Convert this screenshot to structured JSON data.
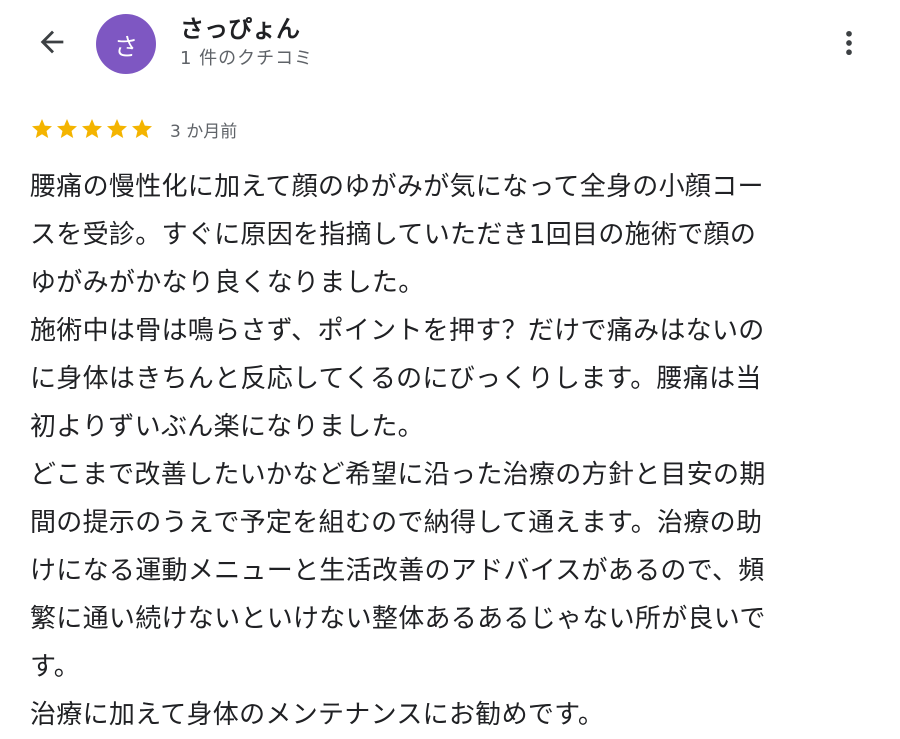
{
  "header": {
    "back_icon": "arrow-back-icon",
    "avatar_initial": "さ",
    "avatar_color": "#7e57c2",
    "user_name": "さっぴょん",
    "review_count": "1 件のクチコミ",
    "more_icon": "more-vert-icon"
  },
  "review": {
    "rating": 5,
    "rating_max": 5,
    "star_color": "#f4b400",
    "date": "3 か月前",
    "lines": [
      "腰痛の慢性化に加えて顔のゆがみが気になって全身の小顔コー",
      "スを受診。すぐに原因を指摘していただき1回目の施術で顔の",
      "ゆがみがかなり良くなりました。",
      "施術中は骨は鳴らさず、ポイントを押す？だけで痛みはないの",
      "に身体はきちんと反応してくるのにびっくりします。腰痛は当",
      "初よりずいぶん楽になりました。",
      "どこまで改善したいかなど希望に沿った治療の方針と目安の期",
      "間の提示のうえで予定を組むので納得して通えます。治療の助",
      "けになる運動メニューと生活改善のアドバイスがあるので、頻",
      "繁に通い続けないといけない整体あるあるじゃない所が良いで",
      "す。",
      "治療に加えて身体のメンテナンスにお勧めです。"
    ]
  }
}
